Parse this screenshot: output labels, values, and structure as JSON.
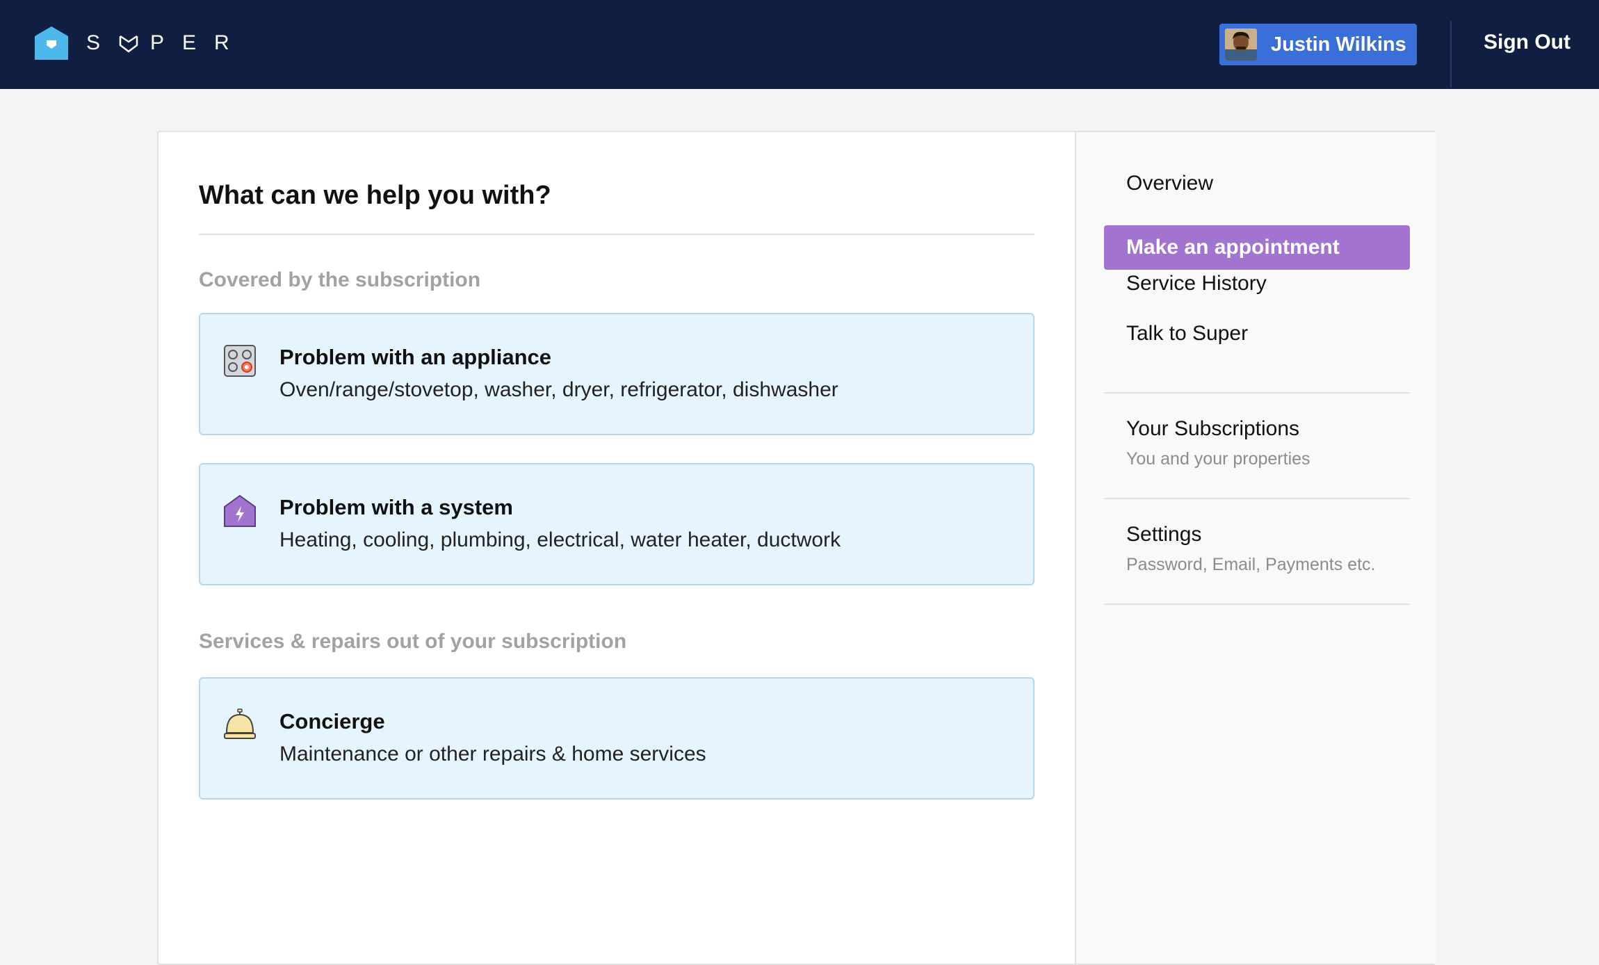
{
  "header": {
    "brand": [
      "S",
      "U",
      "P",
      "E",
      "R"
    ],
    "user_name": "Justin Wilkins",
    "sign_out": "Sign Out",
    "colors": {
      "bar": "#101e42",
      "user_button": "#3a6fd8",
      "logo": "#4cb8ec"
    }
  },
  "main": {
    "title": "What can we help you with?",
    "sections": [
      {
        "label": "Covered by the subscription",
        "options": [
          {
            "icon": "stovetop-icon",
            "title": "Problem with an appliance",
            "description": "Oven/range/stovetop, washer, dryer, refrigerator, dishwasher"
          },
          {
            "icon": "house-lightning-icon",
            "title": "Problem with a system",
            "description": "Heating, cooling, plumbing, electrical, water heater, ductwork"
          }
        ]
      },
      {
        "label": "Services & repairs out of your subscription",
        "options": [
          {
            "icon": "service-bell-icon",
            "title": "Concierge",
            "description": "Maintenance or other repairs & home services"
          }
        ]
      }
    ]
  },
  "sidebar": {
    "nav": [
      {
        "label": "Overview",
        "active": false
      },
      {
        "label": "Make an appointment",
        "active": true
      },
      {
        "label": "Service History",
        "active": false
      },
      {
        "label": "Talk to Super",
        "active": false
      }
    ],
    "subscriptions": {
      "title": "Your Subscriptions",
      "subtitle": "You and your properties"
    },
    "settings": {
      "title": "Settings",
      "subtitle": "Password, Email, Payments etc."
    },
    "active_color": "#a374cf"
  }
}
